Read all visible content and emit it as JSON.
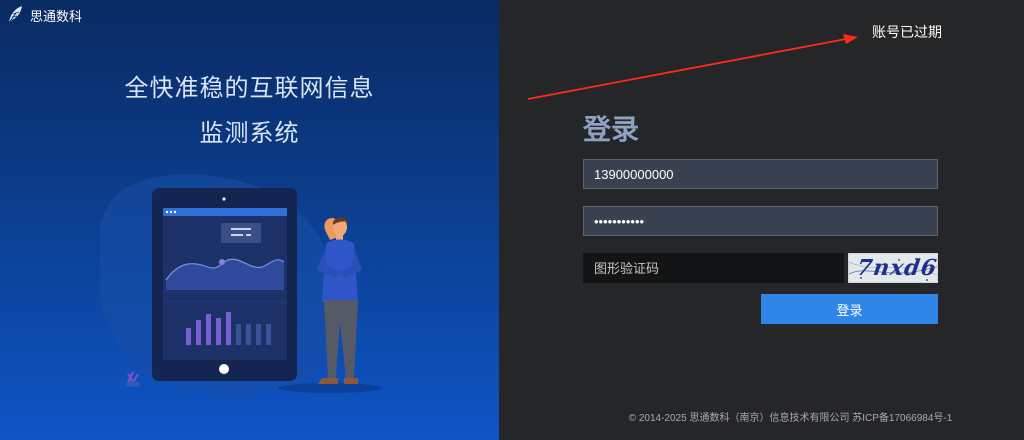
{
  "brand": {
    "name": "思通数科",
    "logo_icon": "feather-logo-icon"
  },
  "hero": {
    "line1": "全快准稳的互联网信息",
    "line2": "监测系统"
  },
  "annotation": {
    "text": "账号已过期",
    "color": "#ff2a1a"
  },
  "login": {
    "title": "登录",
    "phone_value": "13900000000",
    "password_value": "•••••••••••",
    "captcha_placeholder": "图形验证码",
    "captcha_image_text": "7nxd6",
    "submit_label": "登录"
  },
  "footer": {
    "text": "© 2014-2025 思通数科（南京）信息技术有限公司 苏ICP备17066984号-1"
  },
  "colors": {
    "left_bg_top": "#0a2a62",
    "left_bg_bottom": "#0e55c6",
    "right_bg": "#252628",
    "button": "#2f86e8",
    "title": "#8fa2c4"
  }
}
